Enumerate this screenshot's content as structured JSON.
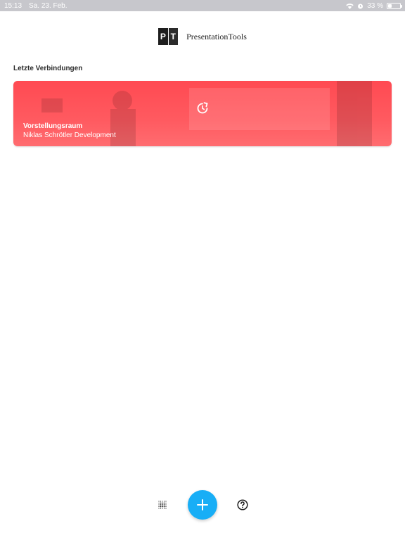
{
  "status_bar": {
    "time": "15:13",
    "date": "Sa. 23. Feb.",
    "battery": "33 %",
    "battery_level": 0.33
  },
  "brand": {
    "logo_letters": [
      "P",
      "T"
    ],
    "name": "PresentationTools"
  },
  "recent": {
    "title": "Letzte Verbindungen",
    "items": [
      {
        "name": "Vorstellungsraum",
        "owner": "Niklas Schrötler Development",
        "icon": "refresh-icon",
        "color": "#ff4f57"
      }
    ]
  },
  "bottom_bar": {
    "left_icon": "dot-matrix-icon",
    "add_icon": "plus-icon",
    "add_color": "#18aef6",
    "right_icon": "help-icon"
  }
}
